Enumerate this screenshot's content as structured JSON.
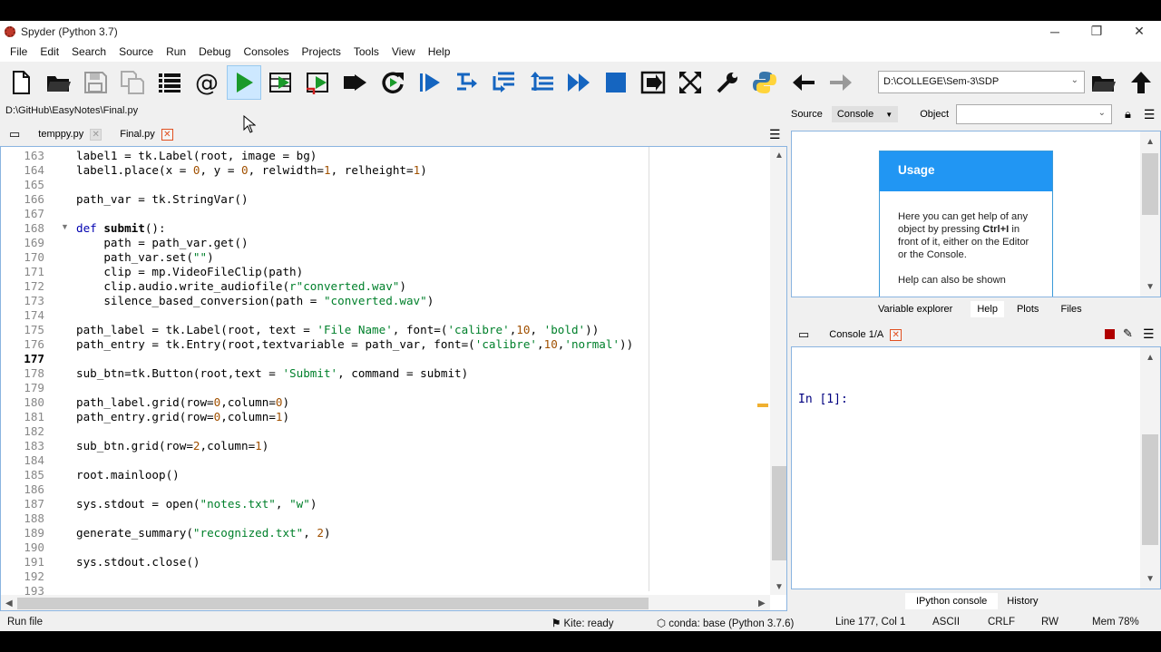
{
  "window": {
    "title": "Spyder (Python 3.7)",
    "controls": {
      "minimize": "─",
      "restore": "❐",
      "close": "✕"
    }
  },
  "menu": [
    "File",
    "Edit",
    "Search",
    "Source",
    "Run",
    "Debug",
    "Consoles",
    "Projects",
    "Tools",
    "View",
    "Help"
  ],
  "toolbar": {
    "working_dir": "D:\\COLLEGE\\Sem-3\\SDP",
    "icons": [
      "new-file",
      "open-file",
      "save",
      "save-all",
      "outline",
      "at-sign",
      "run",
      "run-cell",
      "run-cell-advance",
      "run-selection",
      "re-run",
      "debug",
      "step",
      "step-into",
      "step-return",
      "continue",
      "stop",
      "maximize-pane",
      "fullscreen",
      "preferences",
      "python-path",
      "back",
      "forward",
      "browse-directory",
      "parent-directory"
    ]
  },
  "editor": {
    "file_path": "D:\\GitHub\\EasyNotes\\Final.py",
    "tabs": [
      {
        "label": "temppy.py"
      },
      {
        "label": "Final.py"
      }
    ],
    "current_line": "177",
    "lines": [
      {
        "n": "163",
        "code": "label1 = tk.Label(root, image = bg)"
      },
      {
        "n": "164",
        "code": "label1.place(x = 0, y = 0, relwidth=1, relheight=1)"
      },
      {
        "n": "165",
        "code": ""
      },
      {
        "n": "166",
        "code": "path_var = tk.StringVar()"
      },
      {
        "n": "167",
        "code": ""
      },
      {
        "n": "168",
        "code": "def submit():"
      },
      {
        "n": "169",
        "code": "    path = path_var.get()"
      },
      {
        "n": "170",
        "code": "    path_var.set(\"\")"
      },
      {
        "n": "171",
        "code": "    clip = mp.VideoFileClip(path)"
      },
      {
        "n": "172",
        "code": "    clip.audio.write_audiofile(r\"converted.wav\")"
      },
      {
        "n": "173",
        "code": "    silence_based_conversion(path = \"converted.wav\")"
      },
      {
        "n": "174",
        "code": ""
      },
      {
        "n": "175",
        "code": "path_label = tk.Label(root, text = 'File Name', font=('calibre',10, 'bold'))"
      },
      {
        "n": "176",
        "code": "path_entry = tk.Entry(root,textvariable = path_var, font=('calibre',10,'normal'))"
      },
      {
        "n": "177",
        "code": ""
      },
      {
        "n": "178",
        "code": "sub_btn=tk.Button(root,text = 'Submit', command = submit)"
      },
      {
        "n": "179",
        "code": ""
      },
      {
        "n": "180",
        "code": "path_label.grid(row=0,column=0)"
      },
      {
        "n": "181",
        "code": "path_entry.grid(row=0,column=1)"
      },
      {
        "n": "182",
        "code": ""
      },
      {
        "n": "183",
        "code": "sub_btn.grid(row=2,column=1)"
      },
      {
        "n": "184",
        "code": ""
      },
      {
        "n": "185",
        "code": "root.mainloop()"
      },
      {
        "n": "186",
        "code": ""
      },
      {
        "n": "187",
        "code": "sys.stdout = open(\"notes.txt\", \"w\")"
      },
      {
        "n": "188",
        "code": ""
      },
      {
        "n": "189",
        "code": "generate_summary(\"recognized.txt\", 2)"
      },
      {
        "n": "190",
        "code": ""
      },
      {
        "n": "191",
        "code": "sys.stdout.close()"
      },
      {
        "n": "192",
        "code": ""
      },
      {
        "n": "193",
        "code": ""
      }
    ]
  },
  "help": {
    "source_label": "Source",
    "source_value": "Console",
    "object_label": "Object",
    "object_value": "",
    "usage_title": "Usage",
    "usage_text_1": "Here you can get help of any object by pressing",
    "usage_text_bold": "Ctrl+I",
    "usage_text_2": "in front of it, either on the Editor or the Console.",
    "usage_text_3": "Help can also be shown",
    "tabs": [
      "Variable explorer",
      "Help",
      "Plots",
      "Files"
    ]
  },
  "console": {
    "tab_label": "Console 1/A",
    "prompt": "In [1]:",
    "tabs": [
      "IPython console",
      "History"
    ]
  },
  "status": {
    "message": "Run file",
    "kite": "Kite: ready",
    "conda": "conda: base (Python 3.7.6)",
    "position": "Line 177, Col 1",
    "encoding": "ASCII",
    "eol": "CRLF",
    "permissions": "RW",
    "memory": "Mem 78%"
  },
  "colors": {
    "accent": "#2196f3",
    "keyword": "#0000b0",
    "string": "#00802b",
    "number": "#a05000",
    "run_green": "#1a9a2a"
  }
}
